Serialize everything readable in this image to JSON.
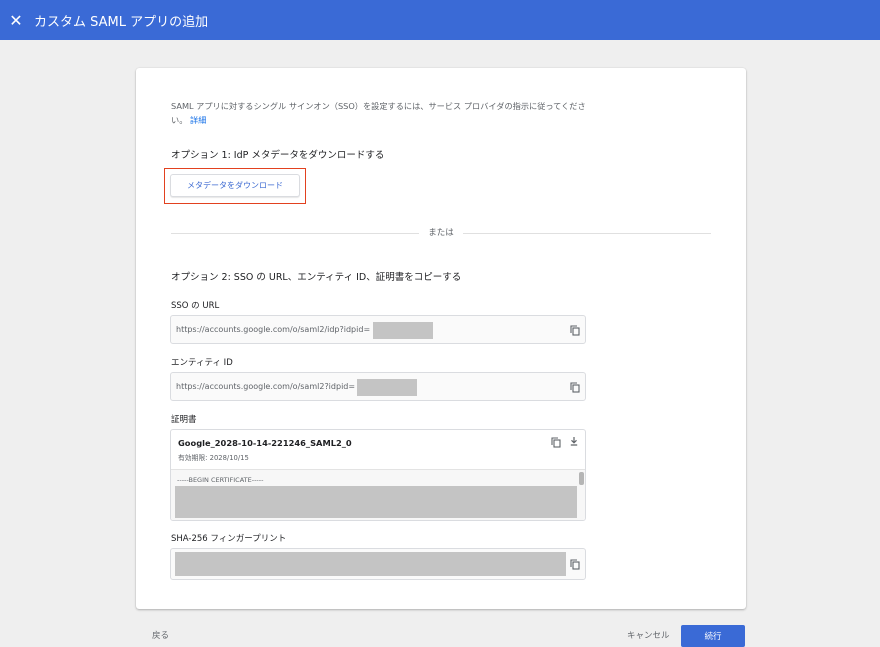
{
  "header": {
    "close_icon": "close-icon",
    "title": "カスタム SAML アプリの追加"
  },
  "main": {
    "description": "SAML アプリに対するシングル サインオン（SSO）を設定するには、サービス プロバイダの指示に従ってください。",
    "learn_more": "詳細",
    "option1_title": "オプション 1: IdP メタデータをダウンロードする",
    "download_button": "メタデータをダウンロード",
    "or_label": "または",
    "option2_title": "オプション 2: SSO の URL、エンティティ ID、証明書をコピーする",
    "sso_url": {
      "label": "SSO の URL",
      "value": "https://accounts.google.com/o/saml2/idp?idpid="
    },
    "entity_id": {
      "label": "エンティティ ID",
      "value": "https://accounts.google.com/o/saml2?idpid="
    },
    "certificate": {
      "label": "証明書",
      "name": "Google_2028-10-14-221246_SAML2_0",
      "expiry": "有効期限: 2028/10/15",
      "begin": "-----BEGIN CERTIFICATE-----"
    },
    "fingerprint": {
      "label": "SHA-256 フィンガープリント"
    }
  },
  "footer": {
    "back": "戻る",
    "cancel": "キャンセル",
    "continue": "続行"
  },
  "colors": {
    "accent": "#3a6ad6",
    "highlight": "#e2411f",
    "link": "#1a73e8"
  }
}
